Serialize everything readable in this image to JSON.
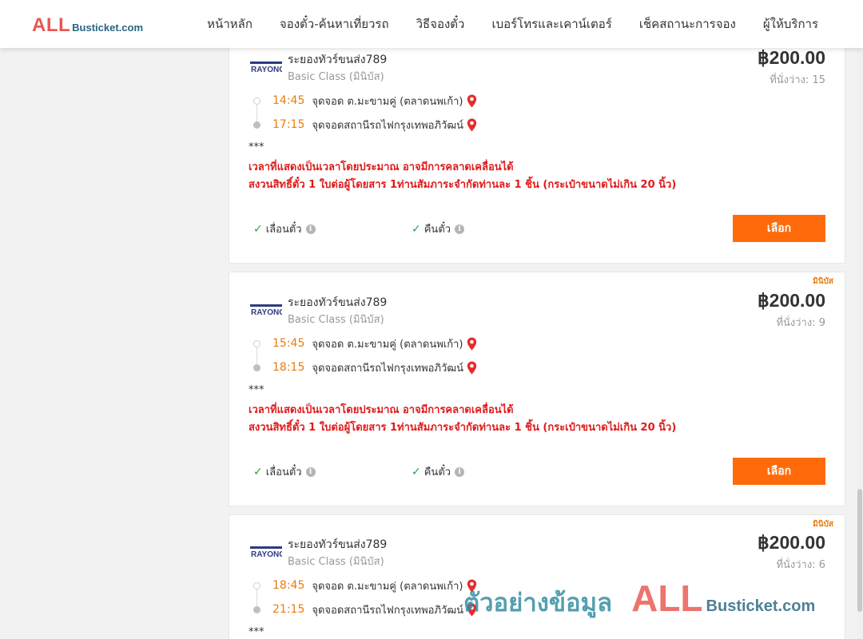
{
  "header": {
    "logo": {
      "all": "ALL",
      "rest": "Busticket.com"
    },
    "nav": [
      "หน้าหลัก",
      "จองตั๋ว-ค้นหาเที่ยวรถ",
      "วิธีจองตั๋ว",
      "เบอร์โทรและเคาน์เตอร์",
      "เช็คสถานะการจอง",
      "ผู้ให้บริการ"
    ]
  },
  "trips": [
    {
      "tag": "",
      "operator_logo": "RAYONG",
      "operator": "ระยองทัวร์ขนส่ง789",
      "class": "Basic Class (มินิบัส)",
      "price": "฿200.00",
      "seats": "ที่นั่งว่าง: 15",
      "depart_time": "14:45",
      "depart_place": "จุดจอด ต.มะขามคู่ (ตลาดนพเก้า)",
      "arrive_time": "17:15",
      "arrive_place": "จุดจอดสถานีรถไฟกรุงเทพอภิวัฒน์",
      "stars": "***",
      "note1": "เวลาที่แสดงเป็นเวลาโดยประมาณ อาจมีการคลาดเคลื่อนได้",
      "note2": "สงวนสิทธิ์ตั๋ว 1 ใบต่อผู้โดยสาร 1ท่านสัมภาระจำกัดท่านละ 1 ชิ้น (กระเป๋าขนาดไม่เกิน 20 นิ้ว)",
      "feature1": "เลื่อนตั๋ว",
      "feature2": "คืนตั๋ว",
      "button": "เลือก"
    },
    {
      "tag": "มินิบัส",
      "operator_logo": "RAYONG",
      "operator": "ระยองทัวร์ขนส่ง789",
      "class": "Basic Class (มินิบัส)",
      "price": "฿200.00",
      "seats": "ที่นั่งว่าง: 9",
      "depart_time": "15:45",
      "depart_place": "จุดจอด ต.มะขามคู่ (ตลาดนพเก้า)",
      "arrive_time": "18:15",
      "arrive_place": "จุดจอดสถานีรถไฟกรุงเทพอภิวัฒน์",
      "stars": "***",
      "note1": "เวลาที่แสดงเป็นเวลาโดยประมาณ อาจมีการคลาดเคลื่อนได้",
      "note2": "สงวนสิทธิ์ตั๋ว 1 ใบต่อผู้โดยสาร 1ท่านสัมภาระจำกัดท่านละ 1 ชิ้น (กระเป๋าขนาดไม่เกิน 20 นิ้ว)",
      "feature1": "เลื่อนตั๋ว",
      "feature2": "คืนตั๋ว",
      "button": "เลือก"
    },
    {
      "tag": "มินิบัส",
      "operator_logo": "RAYONG",
      "operator": "ระยองทัวร์ขนส่ง789",
      "class": "Basic Class (มินิบัส)",
      "price": "฿200.00",
      "seats": "ที่นั่งว่าง: 6",
      "depart_time": "18:45",
      "depart_place": "จุดจอด ต.มะขามคู่ (ตลาดนพเก้า)",
      "arrive_time": "21:15",
      "arrive_place": "จุดจอดสถานีรถไฟกรุงเทพอภิวัฒน์",
      "stars": "***"
    }
  ],
  "watermark": {
    "text": "ตัวอย่างข้อมูล",
    "all": "ALL",
    "rest": "Busticket.com"
  },
  "colors": {
    "brand_red": "#e9564f",
    "brand_teal": "#27657f",
    "accent_orange": "#ff6b0a",
    "note_red": "#e01b1b",
    "time_orange": "#e87d0e"
  }
}
